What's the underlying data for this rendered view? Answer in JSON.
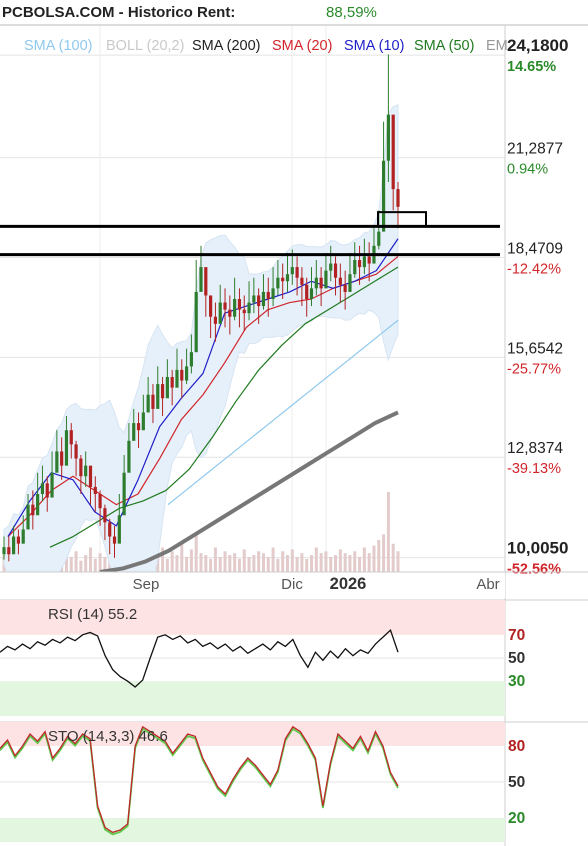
{
  "header": {
    "title": "PCBOLSA.COM - Historico  Rent:",
    "rent_value": "88,59%"
  },
  "legend": [
    {
      "label": "SMA (100)",
      "color": "#8ec9ee"
    },
    {
      "label": "BOLL (20,2)",
      "color": "#c9c9c9"
    },
    {
      "label": "SMA (200)",
      "color": "#222222"
    },
    {
      "label": "SMA (20)",
      "color": "#d0262b"
    },
    {
      "label": "SMA (10)",
      "color": "#1f1fc8"
    },
    {
      "label": "SMA (50)",
      "color": "#1f7a1f"
    },
    {
      "label": "EM",
      "color": "#999999"
    }
  ],
  "price_axis": [
    {
      "price": "24,1800",
      "pct": "14.65%",
      "price_bold": true,
      "pct_color": "#2a8a2a",
      "value": 24.18
    },
    {
      "price": "21,2877",
      "pct": "0.94%",
      "price_bold": false,
      "pct_color": "#2a8a2a",
      "value": 21.2877
    },
    {
      "price": "18,4709",
      "pct": "-12.42%",
      "price_bold": false,
      "pct_color": "#d0262b",
      "value": 18.4709
    },
    {
      "price": "15,6542",
      "pct": "-25.77%",
      "price_bold": false,
      "pct_color": "#d0262b",
      "value": 15.6542
    },
    {
      "price": "12,8374",
      "pct": "-39.13%",
      "price_bold": false,
      "pct_color": "#d0262b",
      "value": 12.8374
    },
    {
      "price": "10,0050",
      "pct": "-52.56%",
      "price_bold": true,
      "pct_color": "#d0262b",
      "value": 10.005
    }
  ],
  "time_axis": [
    {
      "label": "Sep",
      "bold": false
    },
    {
      "label": "Dic",
      "bold": false
    },
    {
      "label": "2026",
      "bold": true
    },
    {
      "label": "Abr",
      "bold": false
    }
  ],
  "horizontal_lines": [
    {
      "value": 19.35
    },
    {
      "value": 18.55
    }
  ],
  "rsi": {
    "title": "RSI (14) 55.2",
    "levels": [
      "70",
      "50",
      "30"
    ],
    "last": 55.2
  },
  "sto": {
    "title": "STO (14,3,3) 46.6",
    "levels": [
      "80",
      "50",
      "20"
    ],
    "last": 46.6
  },
  "chart_data": {
    "type": "candlestick",
    "title": "PCBOLSA.COM - Historico",
    "ylim": [
      9.6,
      25.0
    ],
    "x_labels": [
      "Sep",
      "Dic",
      "2026",
      "Abr"
    ],
    "close_series": [
      10.3,
      10.1,
      10.6,
      10.4,
      10.8,
      11.5,
      11.2,
      11.8,
      12.1,
      11.7,
      12.4,
      13.0,
      12.6,
      13.6,
      13.2,
      12.8,
      12.3,
      12.6,
      12.0,
      11.8,
      11.4,
      11.0,
      10.6,
      10.4,
      11.2,
      12.4,
      13.3,
      13.8,
      13.6,
      14.1,
      14.6,
      14.2,
      14.9,
      14.5,
      15.1,
      14.8,
      15.3,
      15.0,
      15.4,
      15.8,
      17.5,
      18.2,
      17.4,
      16.8,
      16.6,
      17.2,
      17.0,
      16.8,
      17.3,
      17.0,
      16.9,
      17.2,
      17.4,
      17.1,
      17.5,
      17.3,
      17.6,
      17.9,
      17.8,
      18.0,
      18.2,
      17.9,
      17.7,
      17.3,
      17.6,
      17.9,
      17.6,
      18.1,
      18.3,
      17.9,
      17.7,
      17.5,
      18.0,
      18.4,
      18.2,
      18.5,
      18.3,
      18.8,
      19.2,
      21.2,
      22.5,
      20.4,
      19.9
    ],
    "high_series": [
      10.6,
      10.6,
      10.9,
      10.8,
      11.2,
      11.8,
      11.9,
      12.4,
      12.6,
      12.3,
      13.0,
      13.6,
      13.4,
      14.0,
      13.8,
      13.3,
      12.9,
      13.0,
      12.5,
      12.3,
      11.9,
      11.5,
      11.1,
      10.9,
      11.8,
      12.9,
      13.8,
      14.2,
      14.1,
      14.6,
      15.1,
      14.9,
      15.4,
      15.1,
      15.6,
      15.3,
      15.9,
      15.6,
      15.9,
      16.3,
      18.4,
      18.8,
      18.1,
      17.4,
      17.2,
      17.7,
      17.6,
      17.4,
      17.9,
      17.6,
      17.4,
      17.8,
      17.9,
      17.6,
      18.0,
      17.9,
      18.2,
      18.4,
      18.3,
      18.6,
      18.7,
      18.5,
      18.2,
      17.9,
      18.2,
      18.4,
      18.2,
      18.6,
      18.8,
      18.5,
      18.3,
      18.1,
      18.6,
      18.9,
      18.8,
      19.0,
      18.9,
      19.3,
      19.8,
      22.3,
      24.2,
      21.5,
      20.6
    ],
    "low_series": [
      9.95,
      9.9,
      10.2,
      10.1,
      10.4,
      11.0,
      10.8,
      11.3,
      11.6,
      11.3,
      11.9,
      12.5,
      12.2,
      13.1,
      12.8,
      12.3,
      11.8,
      12.0,
      11.5,
      11.3,
      10.9,
      10.5,
      10.1,
      10.0,
      10.7,
      11.8,
      12.8,
      13.3,
      13.1,
      13.6,
      14.1,
      13.8,
      14.4,
      14.0,
      14.6,
      14.3,
      14.8,
      14.5,
      14.9,
      15.2,
      16.4,
      17.6,
      16.8,
      16.2,
      16.1,
      16.6,
      16.5,
      16.3,
      16.7,
      16.5,
      16.4,
      16.7,
      16.9,
      16.6,
      17.0,
      16.8,
      17.1,
      17.4,
      17.3,
      17.5,
      17.7,
      17.4,
      17.1,
      16.8,
      17.1,
      17.4,
      17.1,
      17.6,
      17.8,
      17.4,
      17.2,
      17.0,
      17.5,
      17.9,
      17.7,
      18.0,
      17.8,
      18.3,
      18.7,
      19.6,
      20.6,
      19.8,
      19.3
    ],
    "sma100_series": [
      11.5,
      11.9,
      12.3,
      12.7,
      13.1,
      13.5,
      13.9,
      14.3,
      14.7,
      15.1,
      15.5,
      15.9,
      16.3,
      16.7
    ],
    "sma200_series": [
      9.6,
      9.7,
      9.9,
      10.2,
      10.6,
      11.0,
      11.4,
      11.8,
      12.2,
      12.6,
      13.0,
      13.4,
      13.8,
      14.1
    ],
    "sma50_series": [
      10.3,
      10.6,
      11.0,
      11.4,
      11.6,
      11.9,
      12.5,
      13.4,
      14.4,
      15.3,
      16.0,
      16.6,
      17.0,
      17.4,
      17.8,
      18.2
    ],
    "sma20_series": [
      10.6,
      11.2,
      11.9,
      12.3,
      11.9,
      11.5,
      11.8,
      12.8,
      13.9,
      14.6,
      15.5,
      16.5,
      17.0,
      17.2,
      17.3,
      17.6,
      17.8,
      18.0,
      18.5
    ],
    "sma10_series": [
      10.6,
      11.6,
      12.4,
      12.2,
      11.3,
      10.9,
      12.2,
      13.7,
      14.5,
      15.2,
      16.9,
      17.1,
      17.3,
      17.5,
      17.8,
      17.6,
      17.8,
      18.1,
      19.0
    ],
    "rsi_series": [
      55,
      60,
      57,
      62,
      58,
      64,
      61,
      66,
      63,
      68,
      65,
      70,
      72,
      69,
      52,
      40,
      34,
      30,
      25,
      31,
      50,
      68,
      70,
      66,
      69,
      63,
      66,
      60,
      63,
      58,
      62,
      56,
      60,
      54,
      58,
      62,
      57,
      64,
      60,
      66,
      52,
      42,
      55,
      48,
      56,
      50,
      58,
      52,
      57,
      54,
      62,
      68,
      74,
      55
    ],
    "sto_series": [
      78,
      85,
      72,
      80,
      90,
      84,
      92,
      70,
      78,
      88,
      82,
      90,
      86,
      30,
      12,
      8,
      10,
      15,
      80,
      96,
      92,
      88,
      84,
      74,
      82,
      90,
      88,
      70,
      58,
      46,
      40,
      52,
      62,
      70,
      64,
      56,
      48,
      60,
      86,
      96,
      92,
      82,
      70,
      30,
      66,
      90,
      84,
      78,
      88,
      76,
      92,
      80,
      58,
      46.6
    ],
    "volume_series": [
      18,
      12,
      22,
      14,
      30,
      20,
      16,
      26,
      12,
      18,
      28,
      14,
      20,
      34,
      16,
      22,
      12,
      18,
      26,
      14,
      20,
      16,
      12,
      24,
      30,
      18,
      22,
      14,
      28,
      16,
      20,
      36,
      18,
      26,
      14,
      22,
      18,
      30,
      16,
      24,
      40,
      20,
      18,
      14,
      26,
      16,
      22,
      18,
      20,
      14,
      24,
      16,
      18,
      22,
      20,
      16,
      26,
      14,
      22,
      18,
      24,
      16,
      20,
      14,
      18,
      26,
      20,
      22,
      16,
      18,
      24,
      20,
      18,
      22,
      16,
      26,
      20,
      28,
      34,
      40,
      85,
      30,
      22
    ]
  }
}
